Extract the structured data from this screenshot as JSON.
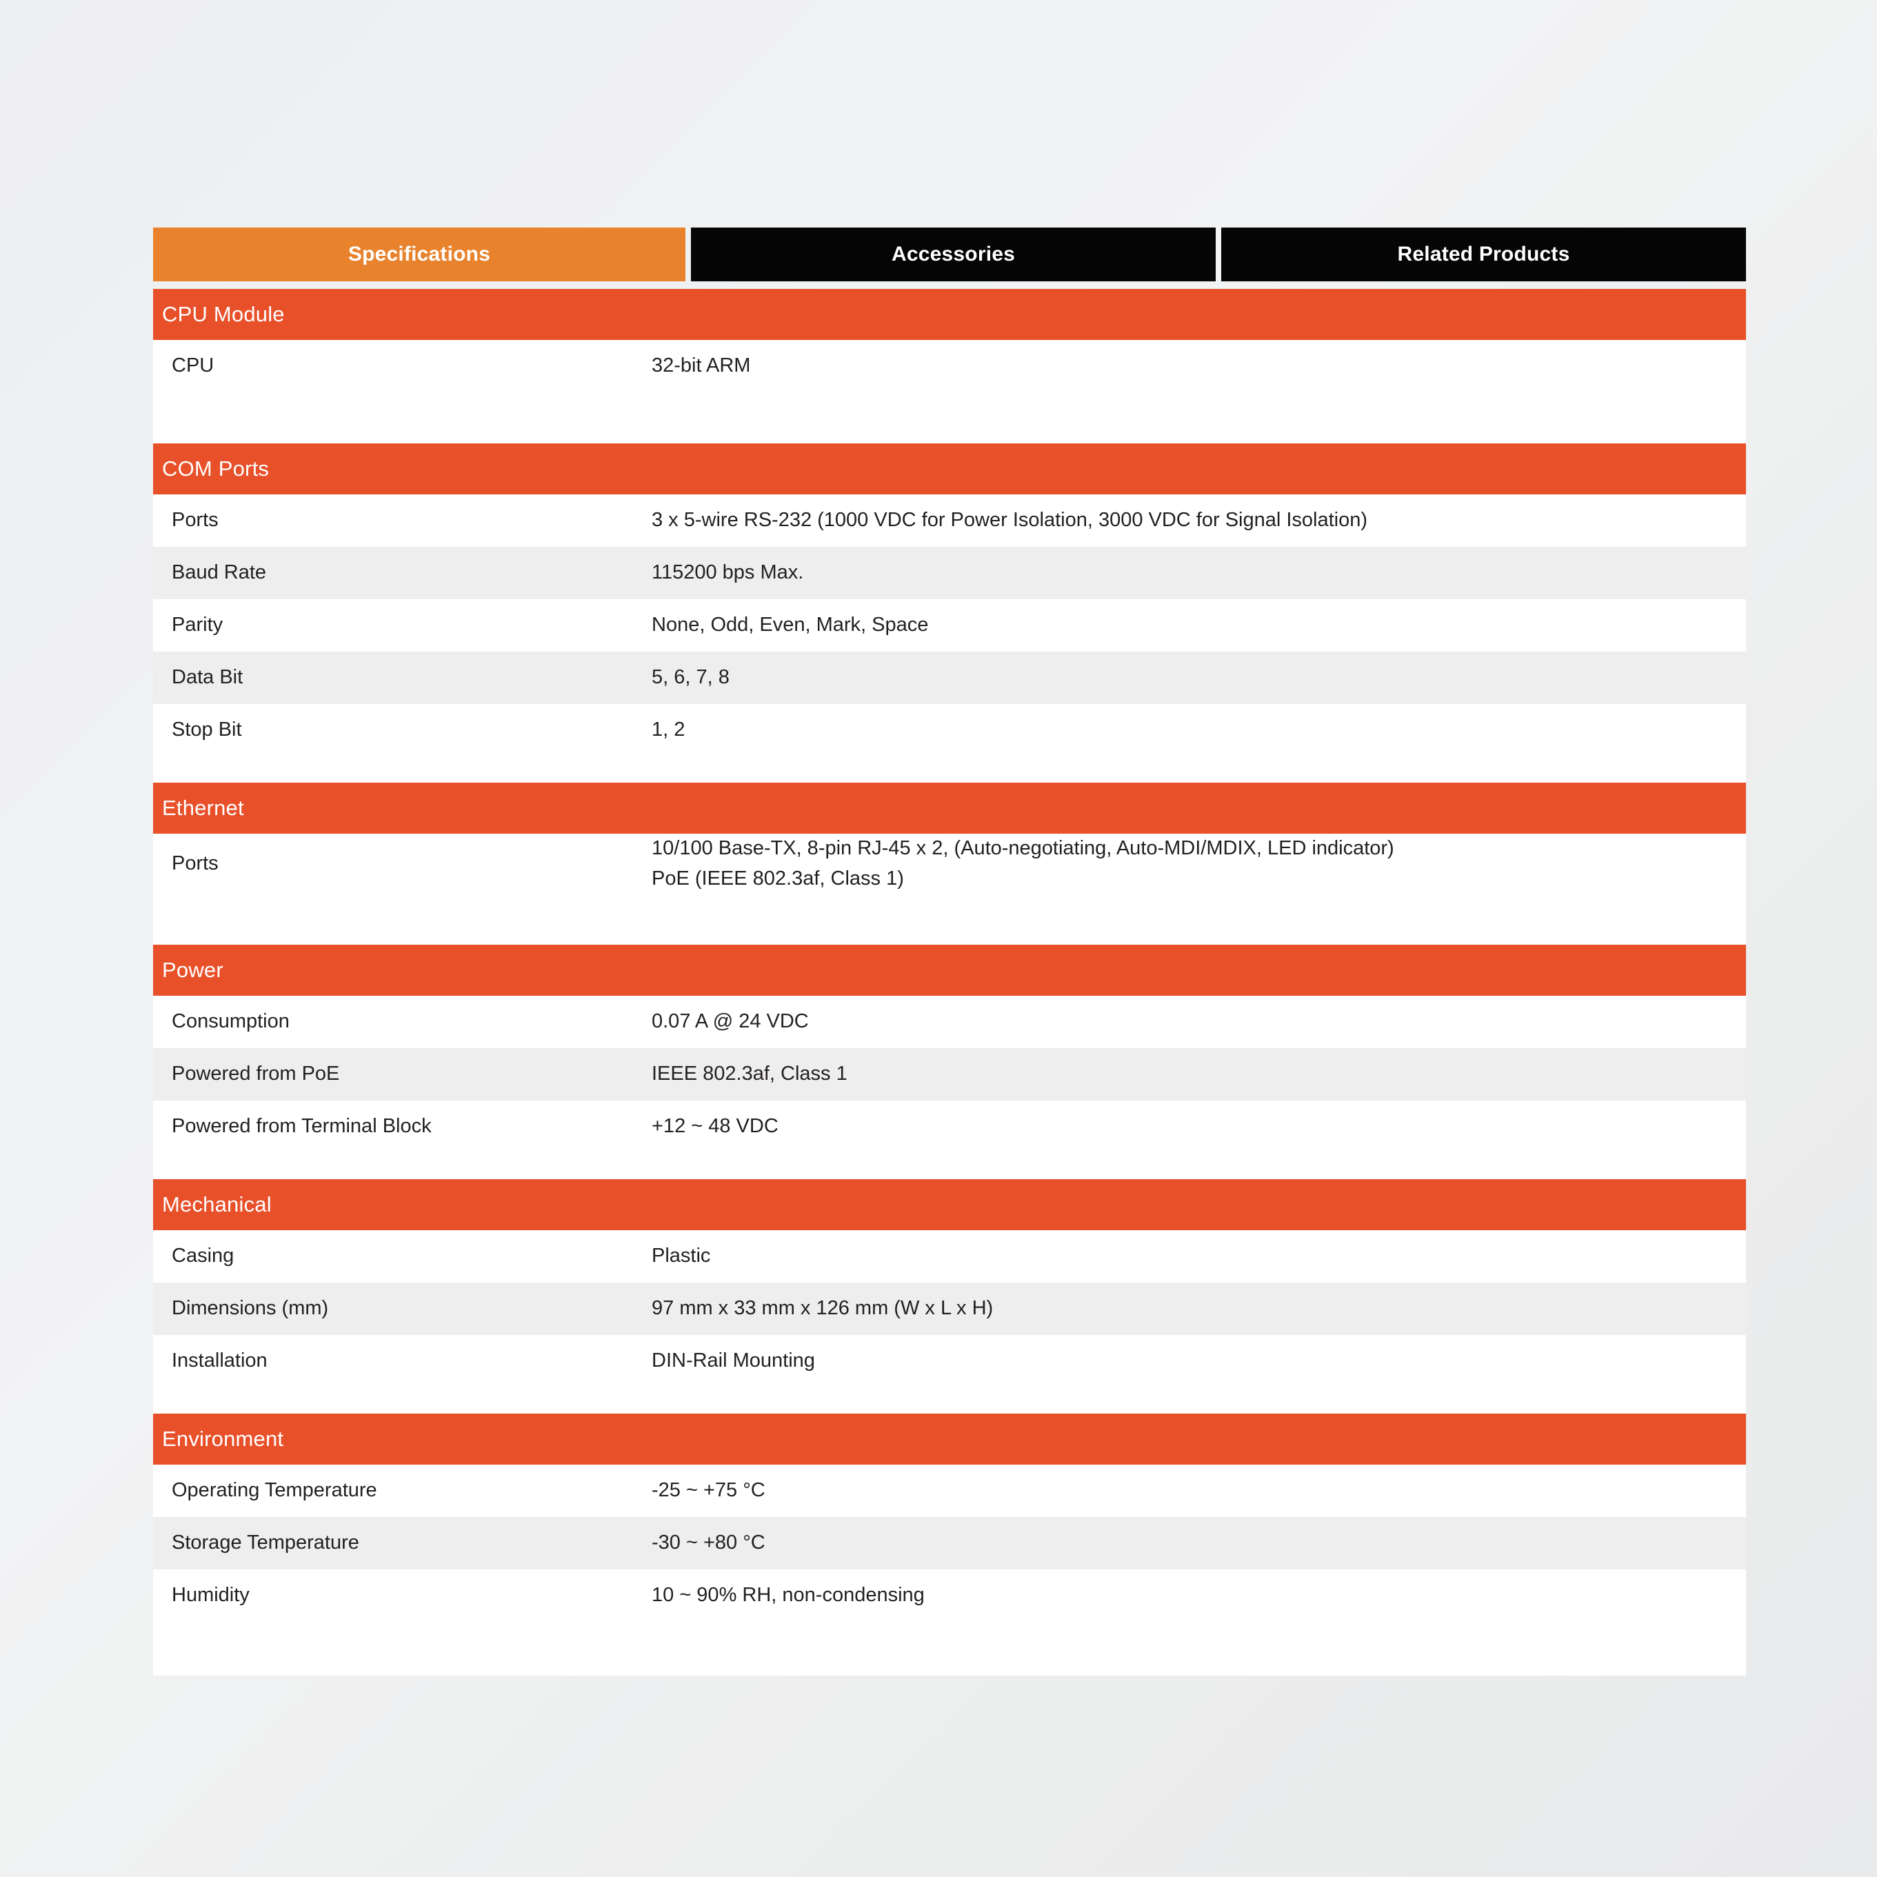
{
  "tabs": [
    {
      "label": "Specifications",
      "active": true
    },
    {
      "label": "Accessories",
      "active": false
    },
    {
      "label": "Related Products",
      "active": false
    }
  ],
  "colors": {
    "tab_active_bg": "#e8822c",
    "tab_inactive_bg": "#050505",
    "section_header_bg": "#e8502a",
    "row_odd_bg": "#ffffff",
    "row_even_bg": "#eeeeee",
    "text": "#231f20",
    "page_bg": "#eceded"
  },
  "sections": [
    {
      "title": "CPU Module",
      "rows": [
        {
          "label": "CPU",
          "value": "32-bit ARM"
        }
      ]
    },
    {
      "title": "COM Ports",
      "rows": [
        {
          "label": "Ports",
          "value": "3 x 5-wire RS-232 (1000 VDC for Power Isolation, 3000 VDC for Signal Isolation)"
        },
        {
          "label": "Baud Rate",
          "value": "115200 bps Max."
        },
        {
          "label": "Parity",
          "value": "None, Odd, Even, Mark, Space"
        },
        {
          "label": "Data Bit",
          "value": "5, 6, 7, 8"
        },
        {
          "label": "Stop Bit",
          "value": "1, 2"
        }
      ]
    },
    {
      "title": "Ethernet",
      "rows": [
        {
          "label": "Ports",
          "value": "10/100 Base-TX, 8-pin RJ-45 x 2, (Auto-negotiating, Auto-MDI/MDIX, LED indicator)\nPoE (IEEE 802.3af, Class 1)"
        }
      ]
    },
    {
      "title": "Power",
      "rows": [
        {
          "label": "Consumption",
          "value": "0.07 A @ 24 VDC"
        },
        {
          "label": "Powered from PoE",
          "value": "IEEE 802.3af, Class 1"
        },
        {
          "label": "Powered from Terminal Block",
          "value": "+12 ~ 48 VDC"
        }
      ]
    },
    {
      "title": "Mechanical",
      "rows": [
        {
          "label": "Casing",
          "value": "Plastic"
        },
        {
          "label": "Dimensions (mm)",
          "value": "97 mm x 33 mm x 126 mm (W x L x H)"
        },
        {
          "label": "Installation",
          "value": "DIN-Rail Mounting"
        }
      ]
    },
    {
      "title": "Environment",
      "rows": [
        {
          "label": "Operating Temperature",
          "value": "-25 ~ +75 °C"
        },
        {
          "label": "Storage Temperature",
          "value": "-30 ~ +80 °C"
        },
        {
          "label": "Humidity",
          "value": "10 ~ 90% RH, non-condensing"
        }
      ]
    }
  ]
}
